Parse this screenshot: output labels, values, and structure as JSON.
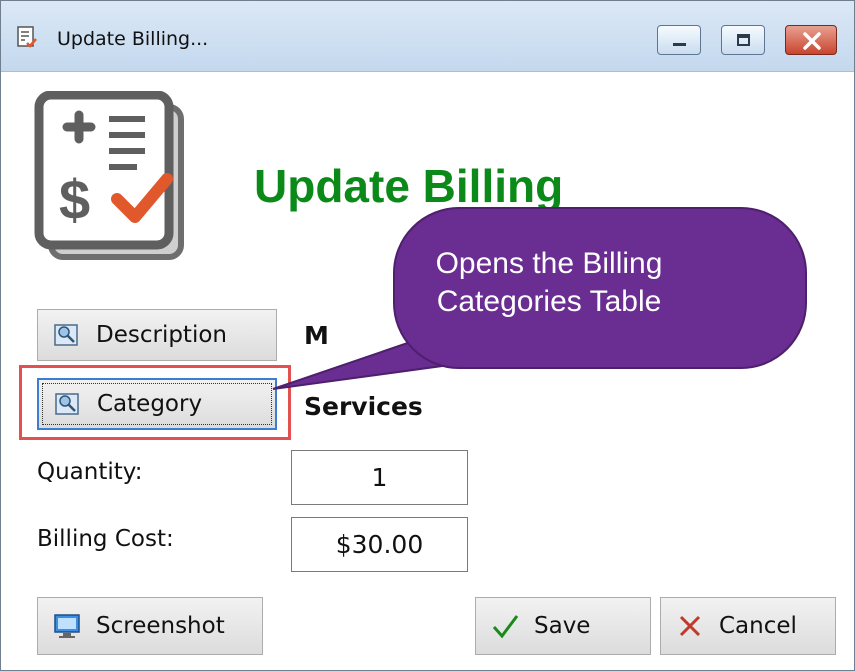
{
  "window": {
    "title": "Update Billing...",
    "app_icon": "billing-doc-icon"
  },
  "header": {
    "title": "Update Billing",
    "logo_icon": "billing-checklist-icon"
  },
  "fields": {
    "description_button": "Description",
    "description_value": "M",
    "category_button": "Category",
    "category_value": "Services",
    "quantity_label": "Quantity:",
    "quantity_value": "1",
    "billing_cost_label": "Billing Cost:",
    "billing_cost_value": "$30.00"
  },
  "buttons": {
    "screenshot": "Screenshot",
    "save": "Save",
    "cancel": "Cancel"
  },
  "callout": {
    "line1": "Opens the Billing",
    "line2": "Categories Table"
  },
  "colors": {
    "heading": "#0b8a1a",
    "callout": "#6a2d91",
    "highlight": "#e35050",
    "checkmark": "#e0582b"
  }
}
